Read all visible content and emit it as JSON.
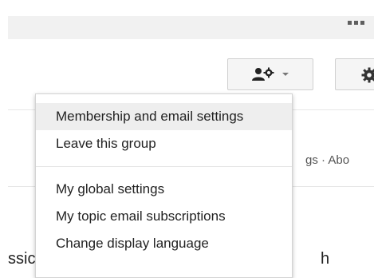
{
  "header": {
    "apps_icon": "apps-grid-icon"
  },
  "toolbar": {
    "member_button_icon": "user-settings-icon",
    "settings_button_icon": "gear-icon"
  },
  "background": {
    "links_fragment": "gs · Abo",
    "text_fragment_left": "ssic",
    "text_fragment_right": "h"
  },
  "menu": {
    "items": [
      {
        "label": "Membership and email settings"
      },
      {
        "label": "Leave this group"
      },
      {
        "label": "My global settings"
      },
      {
        "label": "My topic email subscriptions"
      },
      {
        "label": "Change display language"
      }
    ]
  },
  "colors": {
    "menu_hover_bg": "#eeeeee",
    "border": "#d3d3d3",
    "top_bar_bg": "#f1f1f1"
  }
}
